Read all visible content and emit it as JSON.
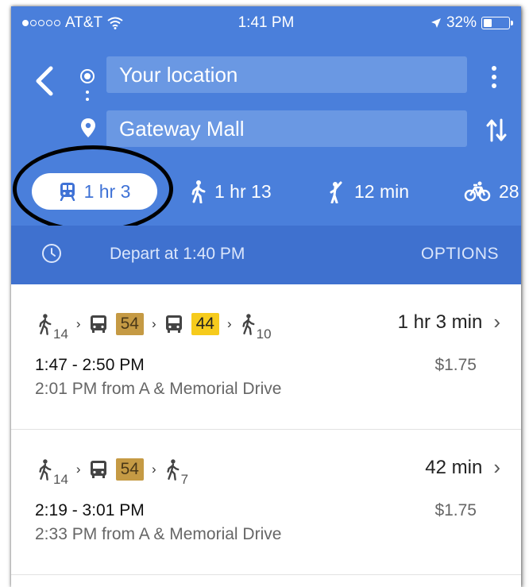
{
  "status_bar": {
    "carrier": "AT&T",
    "time": "1:41 PM",
    "battery": "32%"
  },
  "search": {
    "from": "Your location",
    "to": "Gateway Mall"
  },
  "modes": [
    {
      "label": "1 hr 3",
      "icon": "transit-icon",
      "selected": true
    },
    {
      "label": "1 hr 13",
      "icon": "walking-icon"
    },
    {
      "label": "12 min",
      "icon": "ride-hail-icon"
    },
    {
      "label": "28",
      "icon": "bicycle-icon"
    }
  ],
  "depart_bar": {
    "depart_text": "Depart at 1:40 PM",
    "options_label": "OPTIONS"
  },
  "routes": [
    {
      "steps": [
        {
          "type": "walk",
          "minutes": "14"
        },
        {
          "type": "bus",
          "line": "54"
        },
        {
          "type": "bus",
          "line": "44"
        },
        {
          "type": "walk",
          "minutes": "10"
        }
      ],
      "duration": "1 hr 3 min",
      "time_range": "1:47 - 2:50 PM",
      "fare": "$1.75",
      "departure_info": "2:01 PM from A & Memorial Drive"
    },
    {
      "steps": [
        {
          "type": "walk",
          "minutes": "14"
        },
        {
          "type": "bus",
          "line": "54"
        },
        {
          "type": "walk",
          "minutes": "7"
        }
      ],
      "duration": "42 min",
      "time_range": "2:19 - 3:01 PM",
      "fare": "$1.75",
      "departure_info": "2:33 PM from A & Memorial Drive"
    }
  ],
  "colors": {
    "header_blue": "#4a7fdb",
    "depart_bar_blue": "#3f71cf",
    "line_54_badge": "#c59a44",
    "line_44_badge": "#f6cb1c",
    "annotation_circle": "#000000"
  }
}
